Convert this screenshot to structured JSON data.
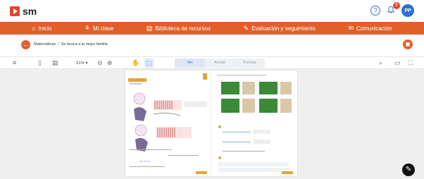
{
  "brand": {
    "name": "sm"
  },
  "topbar": {
    "help": "?",
    "notifications_count": "5",
    "avatar_initials": "PP"
  },
  "nav": [
    {
      "icon": "⌂",
      "label": "Inicio"
    },
    {
      "icon": "⚘",
      "label": "Mi clase"
    },
    {
      "icon": "▤",
      "label": "Biblioteca de recursos"
    },
    {
      "icon": "✎",
      "label": "Evaluación y seguimiento"
    },
    {
      "icon": "✉",
      "label": "Comunicación"
    }
  ],
  "breadcrumb": {
    "section": "Matemáticas",
    "separator": "/",
    "current": "Se busca a la mejor familia"
  },
  "toolbar": {
    "zoom": "31%",
    "tabs": [
      "Ver",
      "Anotar",
      "Formas"
    ]
  },
  "document": {
    "left_page_title": "Se ahorro"
  },
  "colors": {
    "accent": "#e0602a",
    "brand_red": "#e8412c",
    "primary_blue": "#2f6fd0"
  }
}
